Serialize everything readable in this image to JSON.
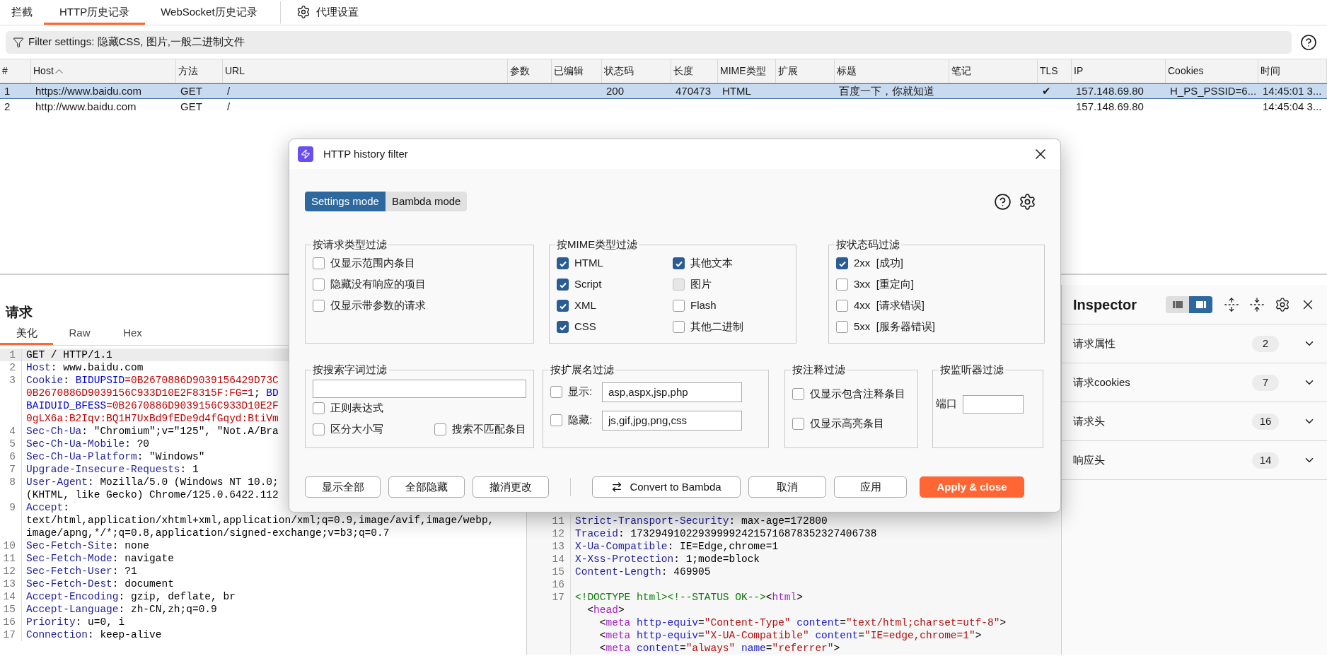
{
  "tabs": [
    {
      "label": "拦截",
      "selected": false,
      "kind": "text"
    },
    {
      "label": "HTTP历史记录",
      "selected": true,
      "kind": "text"
    },
    {
      "label": "WebSocket历史记录",
      "selected": false,
      "kind": "text"
    },
    {
      "label": "代理设置",
      "selected": false,
      "kind": "settings"
    }
  ],
  "filter_bar": {
    "text": "Filter settings: 隐藏CSS, 图片,一般二进制文件"
  },
  "table": {
    "columns": [
      {
        "label": "#",
        "sorted": false
      },
      {
        "label": "Host",
        "sorted": true
      },
      {
        "label": "方法",
        "sorted": false
      },
      {
        "label": "URL",
        "sorted": false
      },
      {
        "label": "参数",
        "sorted": false
      },
      {
        "label": "已编辑",
        "sorted": false
      },
      {
        "label": "状态码",
        "sorted": false
      },
      {
        "label": "长度",
        "sorted": false
      },
      {
        "label": "MIME类型",
        "sorted": false
      },
      {
        "label": "扩展",
        "sorted": false
      },
      {
        "label": "标题",
        "sorted": false
      },
      {
        "label": "笔记",
        "sorted": false
      },
      {
        "label": "TLS",
        "sorted": false
      },
      {
        "label": "IP",
        "sorted": false
      },
      {
        "label": "Cookies",
        "sorted": false
      },
      {
        "label": "时间",
        "sorted": false
      }
    ],
    "rows": [
      {
        "selected": true,
        "cells": [
          "1",
          "https://www.baidu.com",
          "GET",
          "/",
          null,
          null,
          "200",
          "470473",
          "HTML",
          null,
          "百度一下，你就知道",
          null,
          "✔",
          "157.148.69.80",
          "H_PS_PSSID=6...",
          "14:45:01 3..."
        ]
      },
      {
        "selected": false,
        "cells": [
          "2",
          "http://www.baidu.com",
          "GET",
          "/",
          null,
          null,
          null,
          null,
          null,
          null,
          null,
          null,
          null,
          "157.148.69.80",
          null,
          "14:45:04 3..."
        ]
      }
    ]
  },
  "request": {
    "title": "请求",
    "tabs": [
      {
        "label": "美化",
        "selected": true
      },
      {
        "label": "Raw",
        "selected": false
      },
      {
        "label": "Hex",
        "selected": false
      }
    ],
    "lines": [
      {
        "number": "1",
        "highlighted": true,
        "rows": [
          {
            "spans": [
              {
                "kind": "plain",
                "text": "GET / HTTP/1.1"
              }
            ]
          }
        ]
      },
      {
        "number": "2",
        "highlighted": false,
        "rows": [
          {
            "spans": [
              {
                "kind": "name",
                "text": "Host"
              },
              {
                "kind": "plain",
                "text": ": www.baidu.com"
              }
            ]
          }
        ]
      },
      {
        "number": "3",
        "highlighted": false,
        "rows": [
          {
            "spans": [
              {
                "kind": "name",
                "text": "Cookie"
              },
              {
                "kind": "plain",
                "text": ": "
              },
              {
                "kind": "cname",
                "text": "BIDUPSID"
              },
              {
                "kind": "cval",
                "text": "=0B2670886D9039156429D73C"
              }
            ]
          },
          {
            "spans": [
              {
                "kind": "cval",
                "text": "0B2670886D9039156C933D10E2F8315F:FG=1"
              },
              {
                "kind": "plain",
                "text": "; "
              },
              {
                "kind": "cname",
                "text": "BD"
              }
            ]
          },
          {
            "spans": [
              {
                "kind": "cname",
                "text": "BAIDUID_BFESS"
              },
              {
                "kind": "cval",
                "text": "=0B2670886D9039156C933D10E2F"
              }
            ]
          },
          {
            "spans": [
              {
                "kind": "cval",
                "text": "0gLX6a:B2Iqv:BQ1H7UxBd9fEDe9d4fGqyd:BtiVm"
              }
            ]
          }
        ]
      },
      {
        "number": "4",
        "highlighted": false,
        "rows": [
          {
            "spans": [
              {
                "kind": "name",
                "text": "Sec-Ch-Ua"
              },
              {
                "kind": "plain",
                "text": ": \"Chromium\";v=\"125\", \"Not.A/Bra"
              }
            ]
          }
        ]
      },
      {
        "number": "5",
        "highlighted": false,
        "rows": [
          {
            "spans": [
              {
                "kind": "name",
                "text": "Sec-Ch-Ua-Mobile"
              },
              {
                "kind": "plain",
                "text": ": ?0"
              }
            ]
          }
        ]
      },
      {
        "number": "6",
        "highlighted": false,
        "rows": [
          {
            "spans": [
              {
                "kind": "name",
                "text": "Sec-Ch-Ua-Platform"
              },
              {
                "kind": "plain",
                "text": ": \"Windows\""
              }
            ]
          }
        ]
      },
      {
        "number": "7",
        "highlighted": false,
        "rows": [
          {
            "spans": [
              {
                "kind": "name",
                "text": "Upgrade-Insecure-Requests"
              },
              {
                "kind": "plain",
                "text": ": 1"
              }
            ]
          }
        ]
      },
      {
        "number": "8",
        "highlighted": false,
        "rows": [
          {
            "spans": [
              {
                "kind": "name",
                "text": "User-Agent"
              },
              {
                "kind": "plain",
                "text": ": Mozilla/5.0 (Windows NT 10.0;"
              }
            ]
          },
          {
            "spans": [
              {
                "kind": "plain",
                "text": "(KHTML, like Gecko) Chrome/125.0.6422.112"
              }
            ]
          }
        ]
      },
      {
        "number": "9",
        "highlighted": false,
        "rows": [
          {
            "spans": [
              {
                "kind": "name",
                "text": "Accept"
              },
              {
                "kind": "plain",
                "text": ":"
              }
            ]
          },
          {
            "spans": [
              {
                "kind": "plain",
                "text": "text/html,application/xhtml+xml,application/xml;q=0.9,image/avif,image/webp,"
              }
            ]
          },
          {
            "spans": [
              {
                "kind": "plain",
                "text": "image/apng,*/*;q=0.8,application/signed-exchange;v=b3;q=0.7"
              }
            ]
          }
        ]
      },
      {
        "number": "10",
        "highlighted": false,
        "rows": [
          {
            "spans": [
              {
                "kind": "name",
                "text": "Sec-Fetch-Site"
              },
              {
                "kind": "plain",
                "text": ": none"
              }
            ]
          }
        ]
      },
      {
        "number": "11",
        "highlighted": false,
        "rows": [
          {
            "spans": [
              {
                "kind": "name",
                "text": "Sec-Fetch-Mode"
              },
              {
                "kind": "plain",
                "text": ": navigate"
              }
            ]
          }
        ]
      },
      {
        "number": "12",
        "highlighted": false,
        "rows": [
          {
            "spans": [
              {
                "kind": "name",
                "text": "Sec-Fetch-User"
              },
              {
                "kind": "plain",
                "text": ": ?1"
              }
            ]
          }
        ]
      },
      {
        "number": "13",
        "highlighted": false,
        "rows": [
          {
            "spans": [
              {
                "kind": "name",
                "text": "Sec-Fetch-Dest"
              },
              {
                "kind": "plain",
                "text": ": document"
              }
            ]
          }
        ]
      },
      {
        "number": "14",
        "highlighted": false,
        "rows": [
          {
            "spans": [
              {
                "kind": "name",
                "text": "Accept-Encoding"
              },
              {
                "kind": "plain",
                "text": ": gzip, deflate, br"
              }
            ]
          }
        ]
      },
      {
        "number": "15",
        "highlighted": false,
        "rows": [
          {
            "spans": [
              {
                "kind": "name",
                "text": "Accept-Language"
              },
              {
                "kind": "plain",
                "text": ": zh-CN,zh;q=0.9"
              }
            ]
          }
        ]
      },
      {
        "number": "16",
        "highlighted": false,
        "rows": [
          {
            "spans": [
              {
                "kind": "name",
                "text": "Priority"
              },
              {
                "kind": "plain",
                "text": ": u=0, i"
              }
            ]
          }
        ]
      },
      {
        "number": "17",
        "highlighted": false,
        "rows": [
          {
            "spans": [
              {
                "kind": "name",
                "text": "Connection"
              },
              {
                "kind": "plain",
                "text": ": keep-alive"
              }
            ]
          }
        ]
      }
    ]
  },
  "response": {
    "lines": [
      {
        "number": "11",
        "rows": [
          {
            "spans": [
              {
                "kind": "name",
                "text": "Strict-Transport-Security"
              },
              {
                "kind": "plain",
                "text": ": max-age=172800"
              }
            ]
          }
        ]
      },
      {
        "number": "12",
        "rows": [
          {
            "spans": [
              {
                "kind": "name",
                "text": "Traceid"
              },
              {
                "kind": "plain",
                "text": ": 1732949102293999924215716878352327406738"
              }
            ]
          }
        ]
      },
      {
        "number": "13",
        "rows": [
          {
            "spans": [
              {
                "kind": "name",
                "text": "X-Ua-Compatible"
              },
              {
                "kind": "plain",
                "text": ": IE=Edge,chrome=1"
              }
            ]
          }
        ]
      },
      {
        "number": "14",
        "rows": [
          {
            "spans": [
              {
                "kind": "name",
                "text": "X-Xss-Protection"
              },
              {
                "kind": "plain",
                "text": ": 1;mode=block"
              }
            ]
          }
        ]
      },
      {
        "number": "15",
        "rows": [
          {
            "spans": [
              {
                "kind": "name",
                "text": "Content-Length"
              },
              {
                "kind": "plain",
                "text": ": 469905"
              }
            ]
          }
        ]
      },
      {
        "number": "16"
      },
      {
        "number": "17",
        "rows": [
          {
            "spans": [
              {
                "kind": "doc",
                "text": "<!DOCTYPE html><!--STATUS OK-->"
              },
              {
                "kind": "plain",
                "text": "<"
              },
              {
                "kind": "tag",
                "text": "html"
              },
              {
                "kind": "plain",
                "text": ">"
              }
            ]
          },
          {
            "spans": [
              {
                "kind": "plain",
                "text": "  <"
              },
              {
                "kind": "tag",
                "text": "head"
              },
              {
                "kind": "plain",
                "text": ">"
              }
            ]
          },
          {
            "spans": [
              {
                "kind": "plain",
                "text": "    <"
              },
              {
                "kind": "tag",
                "text": "meta"
              },
              {
                "kind": "attr",
                "text": " http-equiv"
              },
              {
                "kind": "plain",
                "text": "="
              },
              {
                "kind": "str",
                "text": "\"Content-Type\""
              },
              {
                "kind": "attr",
                "text": " content"
              },
              {
                "kind": "plain",
                "text": "="
              },
              {
                "kind": "str",
                "text": "\"text/html;charset=utf-8\""
              },
              {
                "kind": "plain",
                "text": ">"
              }
            ]
          },
          {
            "spans": [
              {
                "kind": "plain",
                "text": "    <"
              },
              {
                "kind": "tag",
                "text": "meta"
              },
              {
                "kind": "attr",
                "text": " http-equiv"
              },
              {
                "kind": "plain",
                "text": "="
              },
              {
                "kind": "str",
                "text": "\"X-UA-Compatible\""
              },
              {
                "kind": "attr",
                "text": " content"
              },
              {
                "kind": "plain",
                "text": "="
              },
              {
                "kind": "str",
                "text": "\"IE=edge,chrome=1\""
              },
              {
                "kind": "plain",
                "text": ">"
              }
            ]
          },
          {
            "spans": [
              {
                "kind": "plain",
                "text": "    <"
              },
              {
                "kind": "tag",
                "text": "meta"
              },
              {
                "kind": "attr",
                "text": " content"
              },
              {
                "kind": "plain",
                "text": "="
              },
              {
                "kind": "str",
                "text": "\"always\""
              },
              {
                "kind": "attr",
                "text": " name"
              },
              {
                "kind": "plain",
                "text": "="
              },
              {
                "kind": "str",
                "text": "\"referrer\""
              },
              {
                "kind": "plain",
                "text": ">"
              }
            ]
          }
        ]
      }
    ]
  },
  "inspector": {
    "title": "Inspector",
    "layouts": [
      {
        "kind": "left",
        "selected": false
      },
      {
        "kind": "right",
        "selected": true
      }
    ],
    "sections": [
      {
        "label": "请求属性",
        "count": "2",
        "expanded": false
      },
      {
        "label": "请求cookies",
        "count": "7",
        "expanded": false
      },
      {
        "label": "请求头",
        "count": "16",
        "expanded": false
      },
      {
        "label": "响应头",
        "count": "14",
        "expanded": false
      }
    ]
  },
  "dialog": {
    "title": "HTTP history filter",
    "modes": [
      {
        "label": "Settings mode",
        "selected": true
      },
      {
        "label": "Bambda mode",
        "selected": false
      }
    ],
    "request_type_filter": {
      "title": "按请求类型过滤",
      "options": [
        {
          "label": "仅显示范围内条目",
          "checked": false
        },
        {
          "label": "隐藏没有响应的项目",
          "checked": false
        },
        {
          "label": "仅显示带参数的请求",
          "checked": false
        }
      ]
    },
    "mime_filter": {
      "title": "按MIME类型过滤",
      "options": [
        {
          "label": "HTML",
          "checked": true,
          "disabled": false
        },
        {
          "label": "其他文本",
          "checked": true,
          "disabled": false
        },
        {
          "label": "Script",
          "checked": true,
          "disabled": false
        },
        {
          "label": "图片",
          "checked": false,
          "disabled": true
        },
        {
          "label": "XML",
          "checked": true,
          "disabled": false
        },
        {
          "label": "Flash",
          "checked": false,
          "disabled": false
        },
        {
          "label": "CSS",
          "checked": true,
          "disabled": false
        },
        {
          "label": "其他二进制",
          "checked": false,
          "disabled": false
        }
      ]
    },
    "status_filter": {
      "title": "按状态码过滤",
      "options": [
        {
          "label": "2xx  [成功]",
          "checked": true
        },
        {
          "label": "3xx  [重定向]",
          "checked": false
        },
        {
          "label": "4xx  [请求错误]",
          "checked": false
        },
        {
          "label": "5xx  [服务器错误]",
          "checked": false
        }
      ]
    },
    "search_filter": {
      "title": "按搜索字词过滤",
      "options": [
        {
          "label": "正则表达式",
          "checked": false
        },
        {
          "label": "区分大小写",
          "checked": false
        },
        {
          "label": "搜索不匹配条目",
          "checked": false
        }
      ]
    },
    "extension_filter": {
      "title": "按扩展名过滤",
      "rows": [
        {
          "label": "显示:",
          "checked": false,
          "value": "asp,aspx,jsp,php"
        },
        {
          "label": "隐藏:",
          "checked": false,
          "value": "js,gif,jpg,png,css"
        }
      ]
    },
    "annotation_filter": {
      "title": "按注释过滤",
      "options": [
        {
          "label": "仅显示包含注释条目",
          "checked": false
        },
        {
          "label": "仅显示高亮条目",
          "checked": false
        }
      ]
    },
    "listener_filter": {
      "title": "按监听器过滤",
      "port_label": "端口"
    },
    "buttons": [
      {
        "label": "显示全部",
        "kind": "plain"
      },
      {
        "label": "全部隐藏",
        "kind": "plain"
      },
      {
        "label": "撤消更改",
        "kind": "plain"
      },
      {
        "label": "Convert to Bambda",
        "kind": "convert"
      },
      {
        "label": "取消",
        "kind": "plain"
      },
      {
        "label": "应用",
        "kind": "plain"
      },
      {
        "label": "Apply & close",
        "kind": "primary"
      }
    ]
  }
}
